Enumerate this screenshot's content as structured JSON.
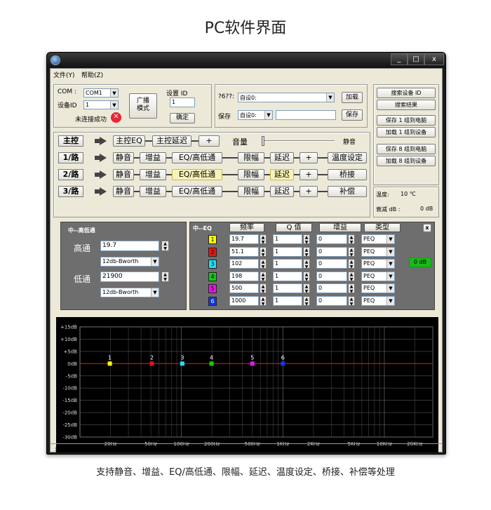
{
  "page_title": "PC软件界面",
  "caption": "支持静音、增益、EQ/高低通、限幅、延迟、温度设定、桥接、补偿等处理",
  "window": {
    "controls": {
      "minimize": "_",
      "maximize": "□",
      "close": "x"
    }
  },
  "menu": {
    "file": "文件(Y)",
    "help": "帮助(Z)"
  },
  "connection": {
    "com_label": "COM :",
    "com_value": "COM1",
    "device_id_label": "设备ID",
    "device_id_value": "1",
    "status": "未连接成功",
    "broadcast_button": "广播\n模式",
    "set_id_label": "设置 ID",
    "set_id_value": "1",
    "confirm_button": "确定"
  },
  "preset": {
    "load_label": "?6??:",
    "load_value": "自设0:",
    "load_button": "加载",
    "save_label": "保存",
    "save_value": "自设0:",
    "save_name": "",
    "save_button": "保存"
  },
  "device_buttons": {
    "search_device": "搜索设备 ID",
    "search_result": "搜索结果",
    "save_group1": "保存 1 组到电脑",
    "load_group1": "加载 1 组到设备",
    "save_group8": "保存 8 组到电脑",
    "load_group8": "加载 8 组到设备"
  },
  "info": {
    "temperature_label": "温度:",
    "temperature_value": "10 ℃",
    "attenuation_label": "衰减 dB :",
    "attenuation_value": "0 dB"
  },
  "master_row": {
    "name": "主控",
    "eq": "主控EQ",
    "delay": "主控延迟",
    "plus": "+",
    "volume_label": "音量",
    "mute_label": "静音"
  },
  "channels": [
    {
      "name": "1/路",
      "mute": "静音",
      "gain": "增益",
      "eq": "EQ/高低通",
      "limit": "限幅",
      "delay": "延迟",
      "plus": "+",
      "extra": "温度设定"
    },
    {
      "name": "2/路",
      "mute": "静音",
      "gain": "增益",
      "eq": "EQ/高低通",
      "limit": "限幅",
      "delay": "延迟",
      "plus": "+",
      "extra": "桥接"
    },
    {
      "name": "3/路",
      "mute": "静音",
      "gain": "增益",
      "eq": "EQ/高低通",
      "limit": "限幅",
      "delay": "延迟",
      "plus": "+",
      "extra": "补偿"
    }
  ],
  "crossover": {
    "title": "中--高低通",
    "highpass_label": "高通",
    "highpass_freq": "19.7",
    "highpass_type": "12db-Bworth",
    "lowpass_label": "低通",
    "lowpass_freq": "21900",
    "lowpass_type": "12db-Bworth"
  },
  "eq_table": {
    "title": "中--EQ",
    "headers": {
      "freq": "频率",
      "q": "Q 值",
      "gain": "增益",
      "type": "类型"
    },
    "close": "x",
    "zero_db_button": "0 dB",
    "bands": [
      {
        "num": "1",
        "color": "#ffff00",
        "freq": "19.7",
        "q": "1",
        "gain": "0",
        "type": "PEQ"
      },
      {
        "num": "2",
        "color": "#ee1111",
        "freq": "51.1",
        "q": "1",
        "gain": "0",
        "type": "PEQ"
      },
      {
        "num": "3",
        "color": "#22e0f0",
        "freq": "102",
        "q": "1",
        "gain": "0",
        "type": "PEQ"
      },
      {
        "num": "4",
        "color": "#11cc11",
        "freq": "198",
        "q": "1",
        "gain": "0",
        "type": "PEQ"
      },
      {
        "num": "5",
        "color": "#ee11ee",
        "freq": "500",
        "q": "1",
        "gain": "0",
        "type": "PEQ"
      },
      {
        "num": "6",
        "color": "#1133ee",
        "freq": "1000",
        "q": "1",
        "gain": "0",
        "type": "PEQ"
      }
    ]
  },
  "chart_data": {
    "type": "line",
    "y_ticks": [
      "+15dB",
      "+10dB",
      "+5dB",
      "0dB",
      "-5dB",
      "-10dB",
      "-15dB",
      "-20dB",
      "-25dB",
      "-30dB"
    ],
    "x_ticks": [
      "20Hz",
      "50Hz",
      "100Hz",
      "200Hz",
      "500Hz",
      "1KHz",
      "2KHz",
      "5KHz",
      "10KHz",
      "20KHz"
    ],
    "ylim": [
      -30,
      15
    ],
    "x_scale": "log",
    "xlim": [
      10,
      30000
    ],
    "grid": true,
    "response_line_color": "#dd1111",
    "points": [
      {
        "label": "1",
        "freq": 19.7,
        "gain": 0,
        "color": "#ffff00"
      },
      {
        "label": "2",
        "freq": 51.1,
        "gain": 0,
        "color": "#ee1111"
      },
      {
        "label": "3",
        "freq": 102,
        "gain": 0,
        "color": "#22e0f0"
      },
      {
        "label": "4",
        "freq": 198,
        "gain": 0,
        "color": "#11cc11"
      },
      {
        "label": "5",
        "freq": 500,
        "gain": 0,
        "color": "#ee11ee"
      },
      {
        "label": "6",
        "freq": 1000,
        "gain": 0,
        "color": "#1133ee"
      }
    ]
  },
  "status_bar": {
    "text": "未连接成功"
  }
}
